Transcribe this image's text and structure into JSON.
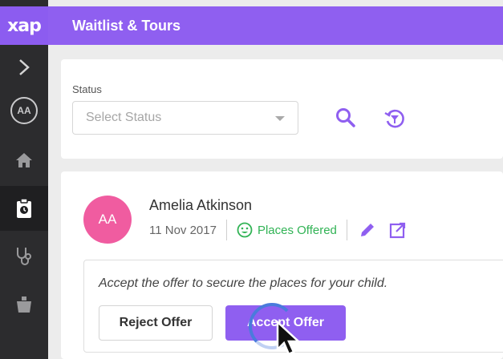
{
  "app": {
    "logo": "xap",
    "title": "Waitlist & Tours"
  },
  "sidebar": {
    "avatar_initials": "AA",
    "items": [
      {
        "name": "expand",
        "icon": "chevron-right-icon"
      },
      {
        "name": "home",
        "icon": "home-icon"
      },
      {
        "name": "waitlist",
        "icon": "clipboard-clock-icon",
        "active": true
      },
      {
        "name": "health",
        "icon": "stethoscope-icon"
      },
      {
        "name": "other",
        "icon": "bucket-icon"
      }
    ]
  },
  "filter": {
    "status_label": "Status",
    "status_placeholder": "Select Status"
  },
  "child": {
    "initials": "AA",
    "name": "Amelia Atkinson",
    "dob": "11 Nov 2017",
    "status": "Places Offered"
  },
  "offer": {
    "message": "Accept the offer to secure the places for your child.",
    "reject_label": "Reject Offer",
    "accept_label": "Accept Offer"
  },
  "colors": {
    "brand": "#8f5ff0",
    "sidebar": "#2c2c2e",
    "status_green": "#31b355",
    "avatar_pink": "#f05ca0"
  }
}
